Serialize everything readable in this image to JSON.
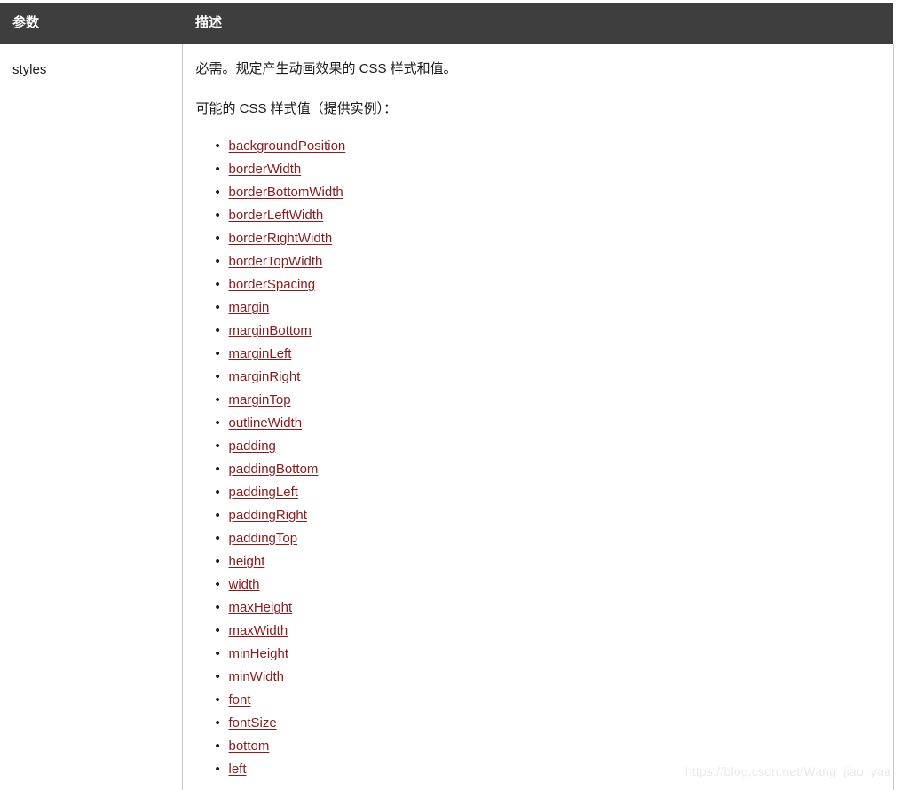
{
  "table": {
    "headers": {
      "parameter": "参数",
      "description": "描述"
    },
    "rows": [
      {
        "parameter": "styles",
        "description": {
          "paragraph_1": "必需。规定产生动画效果的 CSS 样式和值。",
          "paragraph_2": "可能的 CSS 样式值（提供实例）：",
          "style_links": [
            "backgroundPosition",
            "borderWidth",
            "borderBottomWidth",
            "borderLeftWidth",
            "borderRightWidth",
            "borderTopWidth",
            "borderSpacing",
            "margin",
            "marginBottom",
            "marginLeft",
            "marginRight",
            "marginTop",
            "outlineWidth",
            "padding",
            "paddingBottom",
            "paddingLeft",
            "paddingRight",
            "paddingTop",
            "height",
            "width",
            "maxHeight",
            "maxWidth",
            "minHeight",
            "minWidth",
            "font",
            "fontSize",
            "bottom",
            "left"
          ]
        }
      }
    ]
  },
  "watermark": "https://blog.csdn.net/Wang_jiao_yaa",
  "colors": {
    "header_background": "#3e3e3e",
    "header_text": "#ffffff",
    "link": "#8b1a1a",
    "border": "#c7c7c7",
    "body_text": "#1a1a1a",
    "watermark": "#e9e9e9"
  }
}
